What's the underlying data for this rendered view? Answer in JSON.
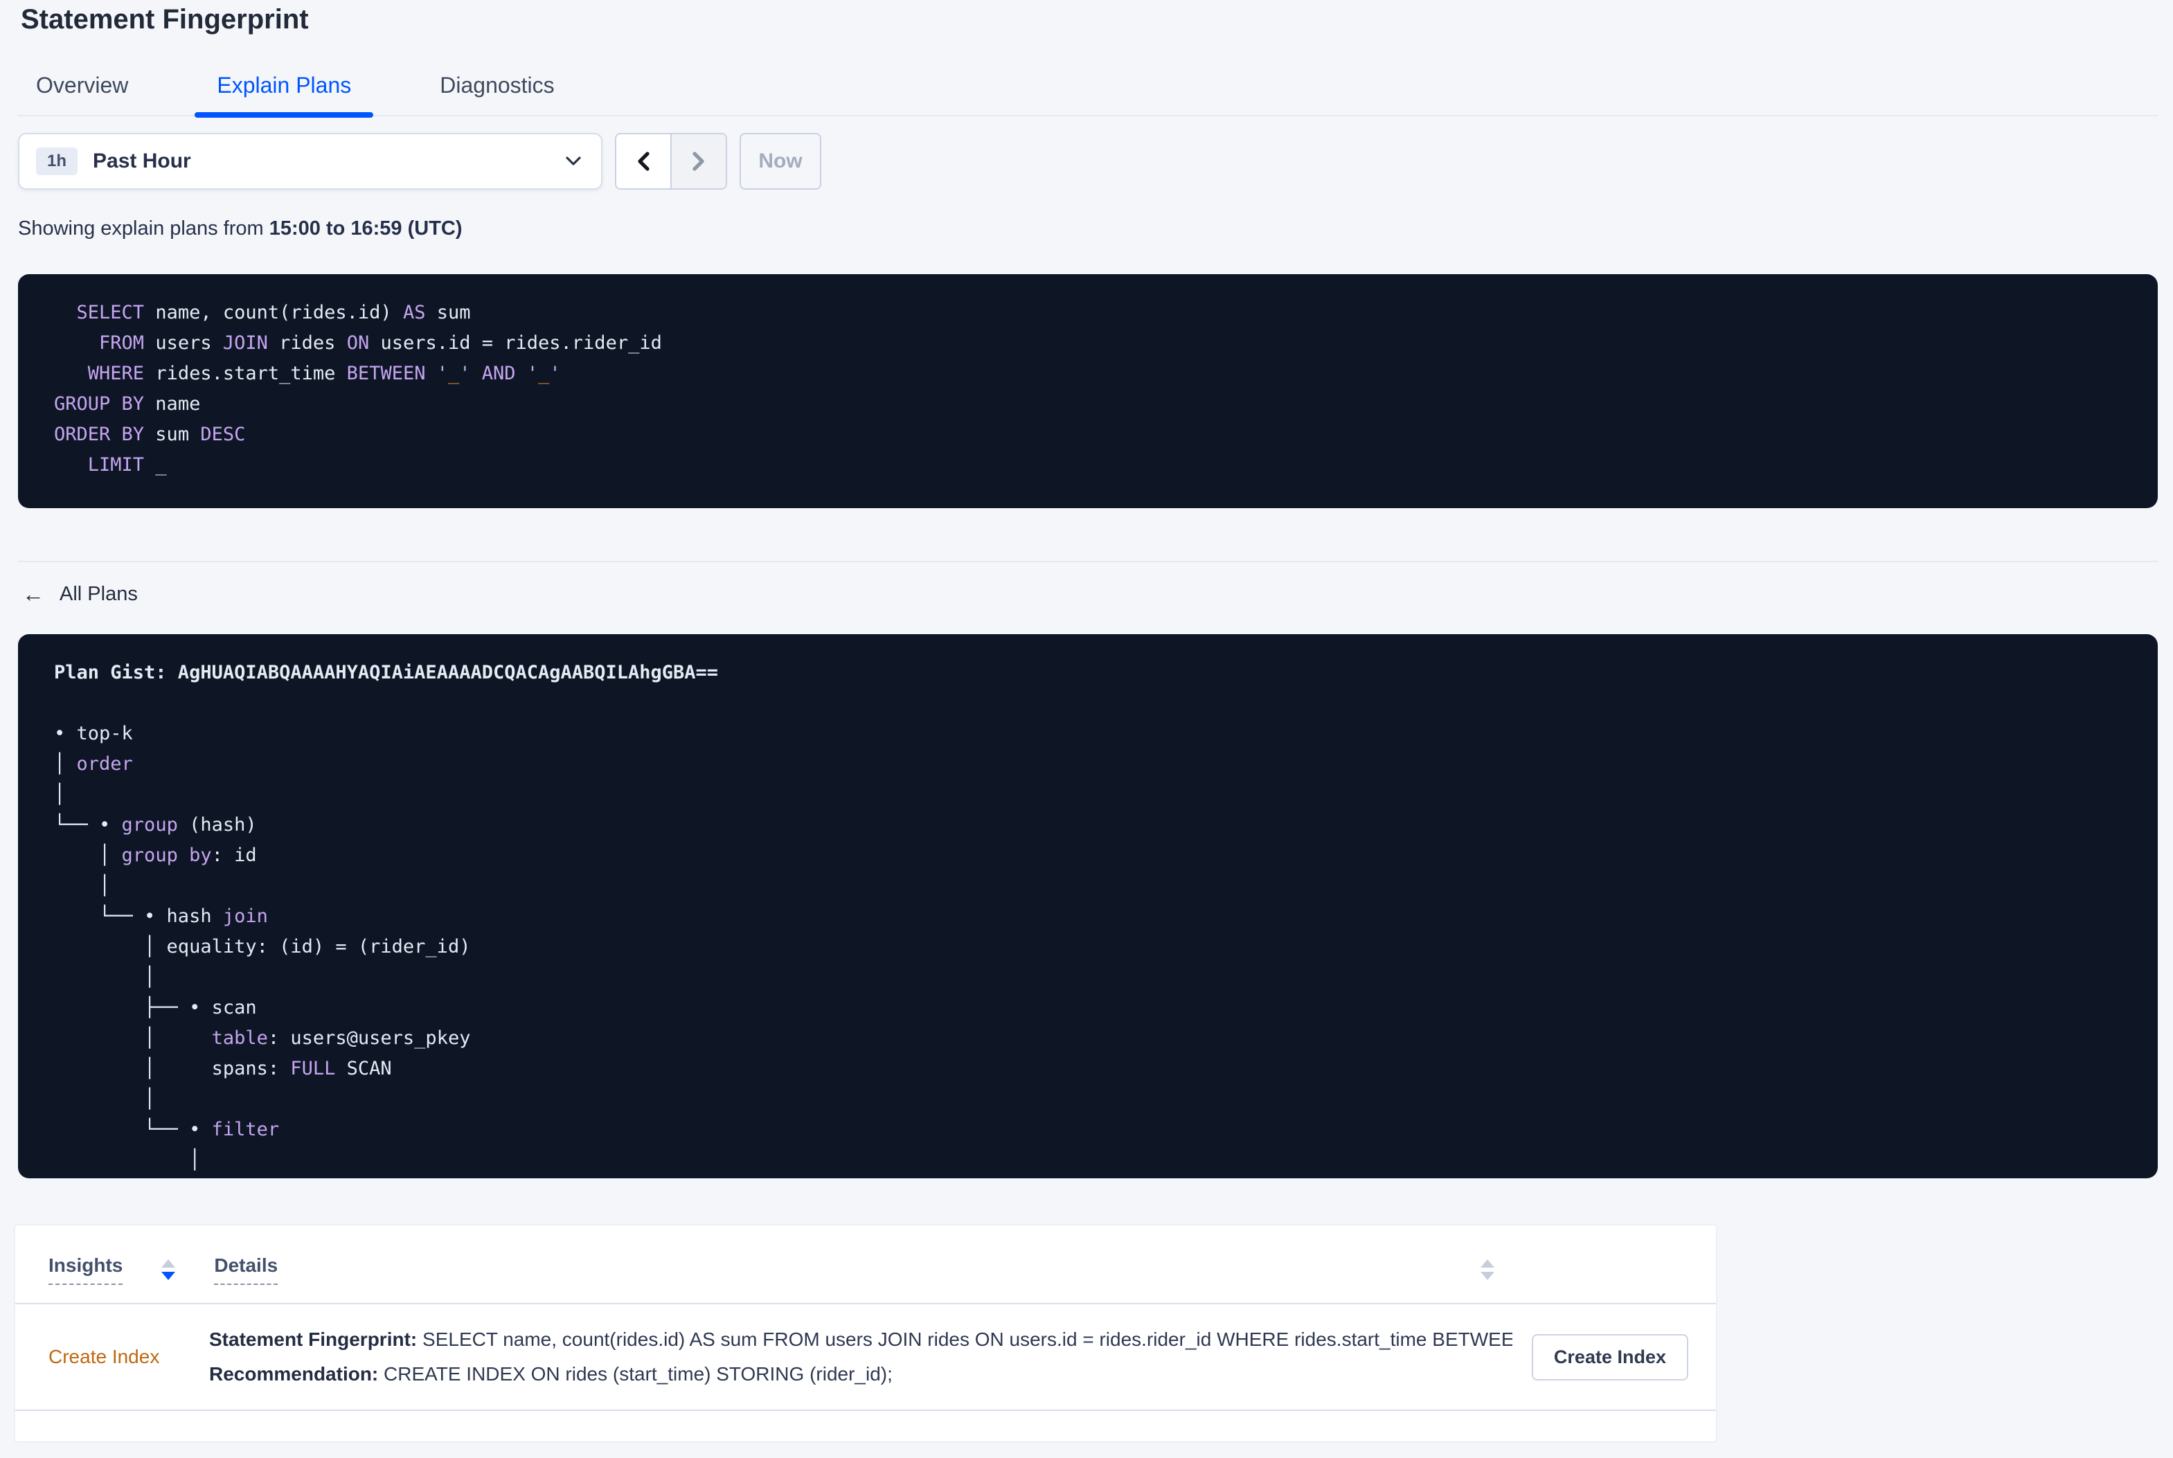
{
  "header": {
    "title": "Statement Fingerprint"
  },
  "tabs": {
    "items": [
      {
        "label": "Overview",
        "active": false
      },
      {
        "label": "Explain Plans",
        "active": true
      },
      {
        "label": "Diagnostics",
        "active": false
      }
    ]
  },
  "controls": {
    "range_badge": "1h",
    "range_label": "Past Hour",
    "now_label": "Now",
    "icons": {
      "dropdown": "chevron-down-icon",
      "prev": "chevron-left-icon",
      "next": "chevron-right-icon"
    }
  },
  "summary": {
    "prefix": "Showing explain plans from ",
    "range_bold": "15:00 to 16:59 (UTC)"
  },
  "sql_box": {
    "lines": [
      [
        {
          "t": "  ",
          "c": ""
        },
        {
          "t": "SELECT",
          "c": "kw"
        },
        {
          "t": " name, count(rides.id) ",
          "c": ""
        },
        {
          "t": "AS",
          "c": "kw"
        },
        {
          "t": " sum",
          "c": ""
        }
      ],
      [
        {
          "t": "    ",
          "c": ""
        },
        {
          "t": "FROM",
          "c": "kw"
        },
        {
          "t": " users ",
          "c": ""
        },
        {
          "t": "JOIN",
          "c": "kw"
        },
        {
          "t": " rides ",
          "c": ""
        },
        {
          "t": "ON",
          "c": "kw"
        },
        {
          "t": " users.id = rides.rider_id",
          "c": ""
        }
      ],
      [
        {
          "t": "   ",
          "c": ""
        },
        {
          "t": "WHERE",
          "c": "kw"
        },
        {
          "t": " rides.start_time ",
          "c": ""
        },
        {
          "t": "BETWEEN",
          "c": "kw"
        },
        {
          "t": " ",
          "c": ""
        },
        {
          "t": "'",
          "c": "kw"
        },
        {
          "t": "_",
          "c": "ph"
        },
        {
          "t": "'",
          "c": "kw"
        },
        {
          "t": " ",
          "c": ""
        },
        {
          "t": "AND",
          "c": "kw"
        },
        {
          "t": " ",
          "c": ""
        },
        {
          "t": "'",
          "c": "kw"
        },
        {
          "t": "_",
          "c": "ph"
        },
        {
          "t": "'",
          "c": "kw"
        }
      ],
      [
        {
          "t": "GROUP BY",
          "c": "kw"
        },
        {
          "t": " name",
          "c": ""
        }
      ],
      [
        {
          "t": "ORDER BY",
          "c": "kw"
        },
        {
          "t": " sum ",
          "c": ""
        },
        {
          "t": "DESC",
          "c": "kw"
        }
      ],
      [
        {
          "t": "   ",
          "c": ""
        },
        {
          "t": "LIMIT",
          "c": "kw"
        },
        {
          "t": " _",
          "c": ""
        }
      ]
    ]
  },
  "back_link": {
    "label": "All Plans",
    "icon": "arrow-left-icon"
  },
  "plan_box": {
    "gist_label": "Plan Gist:",
    "gist": "AgHUAQIABQAAAAHYAQIAiAEAAAADCQACAgAABQILAhgGBA==",
    "lines": [
      [
        {
          "t": "Plan Gist: AgHUAQIABQAAAAHYAQIAiAEAAAADCQACAgAABQILAhgGBA==",
          "c": "b"
        }
      ],
      [],
      [
        {
          "t": "• top-k",
          "c": ""
        }
      ],
      [
        {
          "t": "│ ",
          "c": ""
        },
        {
          "t": "order",
          "c": "kw"
        }
      ],
      [
        {
          "t": "│",
          "c": ""
        }
      ],
      [
        {
          "t": "└── • ",
          "c": ""
        },
        {
          "t": "group",
          "c": "kw"
        },
        {
          "t": " (hash)",
          "c": ""
        }
      ],
      [
        {
          "t": "    │ ",
          "c": ""
        },
        {
          "t": "group by",
          "c": "kw"
        },
        {
          "t": ": id",
          "c": ""
        }
      ],
      [
        {
          "t": "    │",
          "c": ""
        }
      ],
      [
        {
          "t": "    └── • hash ",
          "c": ""
        },
        {
          "t": "join",
          "c": "kw"
        }
      ],
      [
        {
          "t": "        │ equality: (id) = (rider_id)",
          "c": ""
        }
      ],
      [
        {
          "t": "        │",
          "c": ""
        }
      ],
      [
        {
          "t": "        ├── • scan",
          "c": ""
        }
      ],
      [
        {
          "t": "        │     ",
          "c": ""
        },
        {
          "t": "table",
          "c": "kw"
        },
        {
          "t": ": users@users_pkey",
          "c": ""
        }
      ],
      [
        {
          "t": "        │     spans: ",
          "c": ""
        },
        {
          "t": "FULL",
          "c": "kw"
        },
        {
          "t": " SCAN",
          "c": ""
        }
      ],
      [
        {
          "t": "        │",
          "c": ""
        }
      ],
      [
        {
          "t": "        └── • ",
          "c": ""
        },
        {
          "t": "filter",
          "c": "kw"
        }
      ],
      [
        {
          "t": "            │",
          "c": ""
        }
      ],
      [
        {
          "t": "            │",
          "c": ""
        }
      ]
    ]
  },
  "insights_table": {
    "columns": [
      "Insights",
      "Details"
    ],
    "rows": [
      {
        "insight": "Create Index",
        "fingerprint_label": "Statement Fingerprint:",
        "fingerprint_value": " SELECT name, count(rides.id) AS sum FROM users JOIN rides ON users.id = rides.rider_id WHERE rides.start_time BETWEEN '_…",
        "recommendation_label": "Recommendation:",
        "recommendation_value": " CREATE INDEX ON rides (start_time) STORING (rider_id);",
        "action_label": "Create Index"
      }
    ]
  },
  "colors": {
    "accent_blue": "#0055ff",
    "panel_background": "#0e1626",
    "code_keyword": "#c5a5f0",
    "code_placeholder": "#dd8e2b",
    "insight_link_orange": "#bf680f",
    "page_background": "#f4f6fa"
  }
}
